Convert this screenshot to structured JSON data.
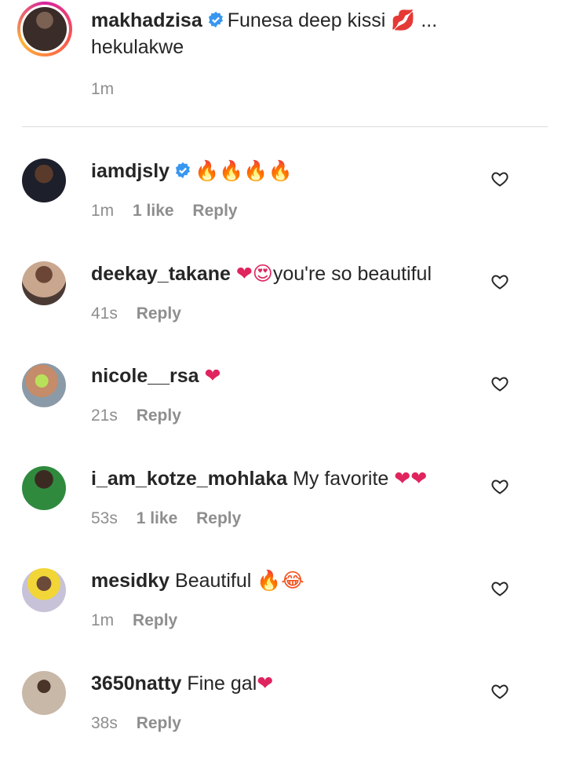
{
  "caption": {
    "username": "makhadzisa",
    "text": "Funesa deep kissi",
    "emoji": "💋",
    "more": "...",
    "line2": "hekulakwe",
    "time": "1m"
  },
  "comments": [
    {
      "username": "iamdjsly",
      "verified": true,
      "text": "",
      "emoji": "🔥🔥🔥🔥",
      "time": "1m",
      "likes": "1 like",
      "reply": "Reply"
    },
    {
      "username": "deekay_takane",
      "verified": false,
      "text": "you're so beautiful",
      "emoji": "❤😍",
      "time": "41s",
      "likes": "",
      "reply": "Reply"
    },
    {
      "username": "nicole__rsa",
      "verified": false,
      "text": "",
      "emoji": "❤",
      "time": "21s",
      "likes": "",
      "reply": "Reply"
    },
    {
      "username": "i_am_kotze_mohlaka",
      "verified": false,
      "text": "My favorite",
      "emoji": "❤❤",
      "time": "53s",
      "likes": "1 like",
      "reply": "Reply"
    },
    {
      "username": "mesidky",
      "verified": false,
      "text": "Beautiful",
      "emoji": "🔥😂",
      "time": "1m",
      "likes": "",
      "reply": "Reply"
    },
    {
      "username": "3650natty",
      "verified": false,
      "text": "Fine gal",
      "emoji": "❤",
      "time": "38s",
      "likes": "",
      "reply": "Reply"
    }
  ],
  "icons": {
    "verified": "verified-badge-icon",
    "like": "heart-outline-icon"
  },
  "colors": {
    "verified": "#3897f0",
    "meta": "#8e8e8e",
    "text": "#262626",
    "heart_emoji": "#e0245e"
  }
}
